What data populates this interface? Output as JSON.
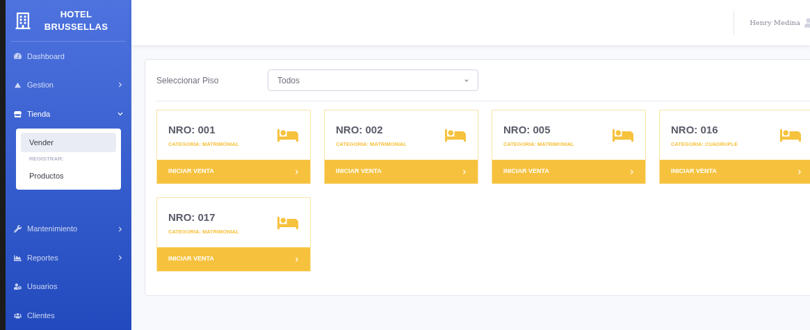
{
  "sidebar": {
    "brand": [
      "HOTEL",
      "BRUSSELLAS"
    ],
    "items": [
      {
        "label": "Dashboard"
      },
      {
        "label": "Gestion",
        "expanded": false
      },
      {
        "label": "Tienda",
        "expanded": true,
        "submenu": [
          {
            "kind": "link",
            "label": "Vender",
            "selected": true
          },
          {
            "kind": "heading",
            "label": "REGISTRAR:"
          },
          {
            "kind": "link",
            "label": "Productos",
            "selected": false
          }
        ]
      },
      {
        "label": "Mantenimiento",
        "expanded": false
      },
      {
        "label": "Reportes",
        "expanded": false
      },
      {
        "label": "Usuarios"
      },
      {
        "label": "Clientes"
      }
    ]
  },
  "topbar": {
    "user_name": "Henry Medina"
  },
  "filter": {
    "label": "Seleccionar Piso",
    "value": "Todos"
  },
  "rooms": [
    {
      "number": "NRO: 001",
      "category": "CATEGORIA: MATRIMONIAL",
      "action": "INICIAR VENTA"
    },
    {
      "number": "NRO: 002",
      "category": "CATEGORIA: MATRIMONIAL",
      "action": "INICIAR VENTA"
    },
    {
      "number": "NRO: 005",
      "category": "CATEGORIA: MATRIMONIAL",
      "action": "INICIAR VENTA"
    },
    {
      "number": "NRO: 016",
      "category": "CATEGORIA: CUADRUPLE",
      "action": "INICIAR VENTA"
    },
    {
      "number": "NRO: 017",
      "category": "CATEGORIA: MATRIMONIAL",
      "action": "INICIAR VENTA"
    }
  ]
}
